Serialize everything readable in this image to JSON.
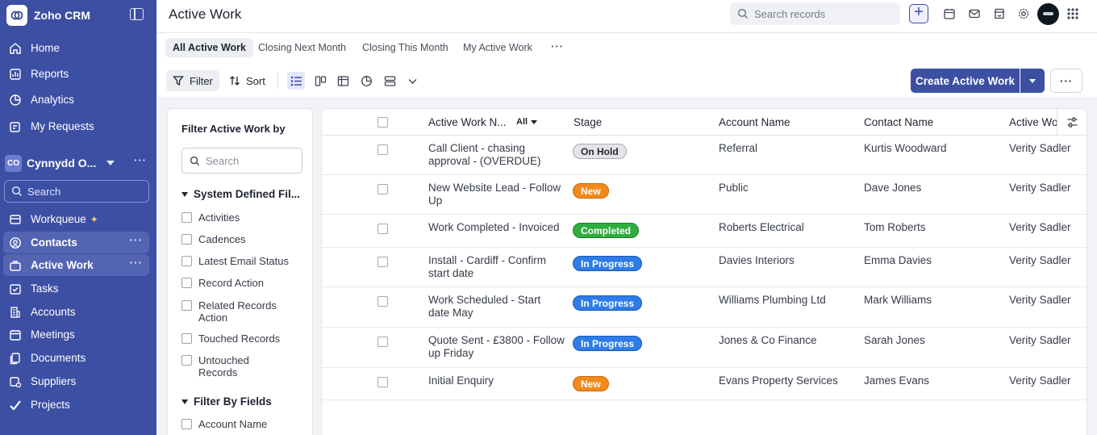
{
  "app": {
    "name": "Zoho CRM"
  },
  "sidebar": {
    "top_items": [
      {
        "label": "Home"
      },
      {
        "label": "Reports"
      },
      {
        "label": "Analytics"
      },
      {
        "label": "My Requests"
      }
    ],
    "workspace": {
      "badge": "CO",
      "name": "Cynnydd O..."
    },
    "search_placeholder": "Search",
    "items": [
      {
        "label": "Workqueue"
      },
      {
        "label": "Contacts"
      },
      {
        "label": "Active Work"
      },
      {
        "label": "Tasks"
      },
      {
        "label": "Accounts"
      },
      {
        "label": "Meetings"
      },
      {
        "label": "Documents"
      },
      {
        "label": "Suppliers"
      },
      {
        "label": "Projects"
      }
    ]
  },
  "header": {
    "title": "Active Work",
    "search_placeholder": "Search records"
  },
  "views": {
    "tabs": [
      {
        "label": "All Active Work"
      },
      {
        "label": "Closing Next Month"
      },
      {
        "label": "Closing This Month"
      },
      {
        "label": "My Active Work"
      }
    ]
  },
  "toolbar": {
    "filter_label": "Filter",
    "sort_label": "Sort",
    "create_label": "Create Active Work"
  },
  "filter_panel": {
    "title": "Filter Active Work by",
    "search_placeholder": "Search",
    "system_section": "System Defined Fil...",
    "system_items": [
      {
        "label": "Activities"
      },
      {
        "label": "Cadences"
      },
      {
        "label": "Latest Email Status"
      },
      {
        "label": "Record Action"
      },
      {
        "label": "Related Records Action"
      },
      {
        "label": "Touched Records"
      },
      {
        "label": "Untouched Records"
      }
    ],
    "fields_section": "Filter By Fields",
    "field_items": [
      {
        "label": "Account Name"
      }
    ]
  },
  "table": {
    "columns": {
      "name": "Active Work N...",
      "name_filter": "All",
      "stage": "Stage",
      "account": "Account Name",
      "contact": "Contact Name",
      "owner": "Active Wo"
    },
    "rows": [
      {
        "name": "Call Client - chasing approval - (OVERDUE)",
        "stage": "On Hold",
        "account": "Referral",
        "contact": "Kurtis Woodward",
        "owner": "Verity Sadler"
      },
      {
        "name": "New Website Lead - Follow Up",
        "stage": "New",
        "account": "Public",
        "contact": "Dave Jones",
        "owner": "Verity Sadler"
      },
      {
        "name": "Work Completed - Invoiced",
        "stage": "Completed",
        "account": "Roberts Electrical",
        "contact": "Tom Roberts",
        "owner": "Verity Sadler"
      },
      {
        "name": "Install - Cardiff - Confirm start date",
        "stage": "In Progress",
        "account": "Davies Interiors",
        "contact": "Emma Davies",
        "owner": "Verity Sadler"
      },
      {
        "name": "Work Scheduled - Start date May",
        "stage": "In Progress",
        "account": "Williams Plumbing Ltd",
        "contact": "Mark Williams",
        "owner": "Verity Sadler"
      },
      {
        "name": "Quote Sent - £3800 - Follow up Friday",
        "stage": "In Progress",
        "account": "Jones & Co Finance",
        "contact": "Sarah Jones",
        "owner": "Verity Sadler"
      },
      {
        "name": "Initial Enquiry",
        "stage": "New",
        "account": "Evans Property Services",
        "contact": "James Evans",
        "owner": "Verity Sadler"
      }
    ]
  },
  "colors": {
    "sidebar": "#3c4fa3",
    "on_hold": "#e4e5e8",
    "new": "#f28a1b",
    "completed": "#2fad3f",
    "in_progress": "#2f7ce8"
  }
}
